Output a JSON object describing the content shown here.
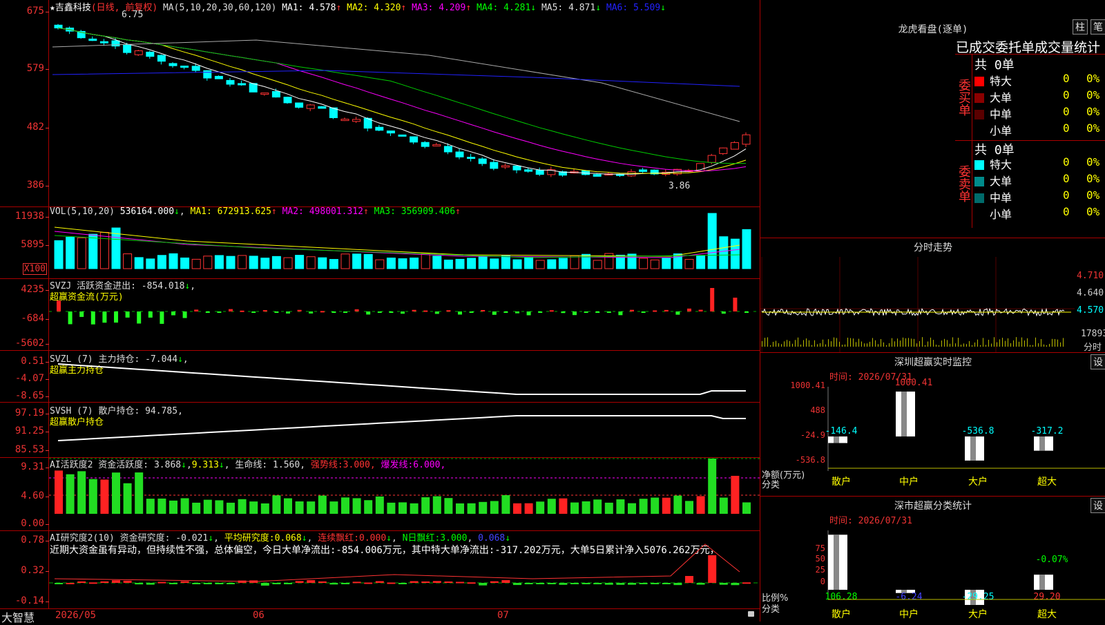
{
  "main_pane": {
    "star": "★",
    "stock_name": "吉鑫科技",
    "period": "(日线, 前复权)",
    "ma_header": "MA(5,10,20,30,60,120)",
    "ma_values": [
      {
        "label": "MA1:",
        "value": "4.578",
        "arrow": "↑",
        "color": "#ffffff"
      },
      {
        "label": "MA2:",
        "value": "4.320",
        "arrow": "↑",
        "color": "#ffff00"
      },
      {
        "label": "MA3:",
        "value": "4.209",
        "arrow": "↑",
        "color": "#ff00ff"
      },
      {
        "label": "MA4:",
        "value": "4.281",
        "arrow": "↓",
        "color": "#00ff00"
      },
      {
        "label": "MA5:",
        "value": "4.871",
        "arrow": "↓",
        "color": "#dddddd"
      },
      {
        "label": "MA6:",
        "value": "5.509",
        "arrow": "↓",
        "color": "#2222ff"
      }
    ],
    "high_label": "6.75",
    "low_label": "3.86",
    "y_ticks": [
      "675",
      "579",
      "482",
      "386"
    ]
  },
  "vol_pane": {
    "header": "VOL(5,10,20)",
    "value": "536164.000",
    "ma": [
      {
        "label": "MA1:",
        "value": "672913.625",
        "arrow": "↑",
        "color": "#ffff00"
      },
      {
        "label": "MA2:",
        "value": "498001.312",
        "arrow": "↑",
        "color": "#ff00ff"
      },
      {
        "label": "MA3:",
        "value": "356909.406",
        "arrow": "↑",
        "color": "#00ff00"
      }
    ],
    "y_ticks": [
      "11938",
      "5895"
    ],
    "unit": "X100"
  },
  "svzj_pane": {
    "header": "SVZJ  活跃资金进出:",
    "value": "-854.018",
    "subtitle": "超赢资金流(万元)",
    "y_ticks": [
      "4235",
      "-684",
      "-5602"
    ]
  },
  "svzl_pane": {
    "header": "SVZL (7) 主力持仓:",
    "value": "-7.044",
    "subtitle": "超赢主力持仓",
    "y_ticks": [
      "0.51",
      "-4.07",
      "-8.65"
    ]
  },
  "svsh_pane": {
    "header": "SVSH (7) 散户持仓:",
    "value": "94.785",
    "subtitle": "超赢散户持仓",
    "y_ticks": [
      "97.19",
      "91.25",
      "85.53"
    ]
  },
  "ai_active_pane": {
    "header": "AI活跃度2 资金活跃度:",
    "value1": "3.868",
    "value2": "9.313",
    "life_label": "生命线:",
    "life_value": "1.560",
    "strong_label": "强势线:",
    "strong_value": "3.000",
    "burst_label": "爆发线:",
    "burst_value": "6.000",
    "y_ticks": [
      "9.31",
      "4.60",
      "0.00"
    ]
  },
  "ai_research_pane": {
    "header": "AI研究度2(10) 资金研究度:",
    "value": "-0.021",
    "avg_label": "平均研究度:",
    "avg_value": "0.068",
    "red_label": "连续飘红:",
    "red_value": "0.000",
    "nday_label": "N日飘红:",
    "nday_value": "3.000",
    "extra_value": "0.068",
    "commentary": "近期大资金虽有异动，但持续性不强，总体偏空，今日大单净流出:-854.006万元，其中特大单净流出:-317.202万元，大单5日累计净入5076.262万元，",
    "y_ticks": [
      "0.78",
      "0.32",
      "-0.14"
    ]
  },
  "bottom_bar": {
    "brand": "大智慧",
    "dates": [
      "2026/05",
      "06",
      "07"
    ]
  },
  "dragon_tiger": {
    "title": "龙虎看盘(逐单)",
    "btn_bar": "柱",
    "btn_pen": "笔",
    "subtitle": "已成交委托单成交量统计",
    "buy_label": "委买单",
    "sell_label": "委卖单",
    "buy_total": "共 0单",
    "sell_total": "共 0单",
    "buy_rows": [
      {
        "name": "特大",
        "count": "0",
        "pct": "0%",
        "color": "#ff0000"
      },
      {
        "name": "大单",
        "count": "0",
        "pct": "0%",
        "color": "#8b0000"
      },
      {
        "name": "中单",
        "count": "0",
        "pct": "0%",
        "color": "#5a0000"
      },
      {
        "name": "小单",
        "count": "0",
        "pct": "0%",
        "color": "#000000"
      }
    ],
    "sell_rows": [
      {
        "name": "特大",
        "count": "0",
        "pct": "0%",
        "color": "#00ffff"
      },
      {
        "name": "大单",
        "count": "0",
        "pct": "0%",
        "color": "#008b8b"
      },
      {
        "name": "中单",
        "count": "0",
        "pct": "0%",
        "color": "#006b6b"
      },
      {
        "name": "小单",
        "count": "0",
        "pct": "0%",
        "color": "#000000"
      }
    ]
  },
  "intraday": {
    "title": "分时走势",
    "price_ticks": [
      "4.710",
      "4.640",
      "4.570"
    ],
    "vol_tick": "17893",
    "vol_label": "分时"
  },
  "sz_monitor": {
    "title": "深圳超赢实时监控",
    "settings": "设",
    "time": "时间: 2026/07/31",
    "y_ticks": [
      "1000.41",
      "488",
      "-24.9",
      "-536.8"
    ],
    "y_label": "净额(万元)",
    "x_label": "分类",
    "top_label": "1000.41",
    "categories": [
      "散户",
      "中户",
      "大户",
      "超大"
    ],
    "values": [
      -146.4,
      1000.41,
      -536.8,
      -317.2
    ],
    "value_labels": [
      "-146.4",
      "",
      "-536.8",
      "-317.2"
    ],
    "value_colors": [
      "#00ffff",
      "#ff3333",
      "#00ffff",
      "#00ffff"
    ]
  },
  "sz_stats": {
    "title": "深市超赢分类统计",
    "settings": "设",
    "time": "时间: 2026/07/31",
    "y_ticks": [
      "75",
      "50",
      "25",
      "0"
    ],
    "y_label": "比例%",
    "x_label": "分类",
    "top_label": "-0.07%",
    "categories": [
      "散户",
      "中户",
      "大户",
      "超大"
    ],
    "values": [
      106.28,
      -6.24,
      -29.25,
      29.2
    ],
    "value_labels": [
      "106.28",
      "-6.24",
      "-29.25",
      "29.20"
    ],
    "value_colors": [
      "#00ff00",
      "#4444ff",
      "#00ffff",
      "#ff3333"
    ]
  }
}
